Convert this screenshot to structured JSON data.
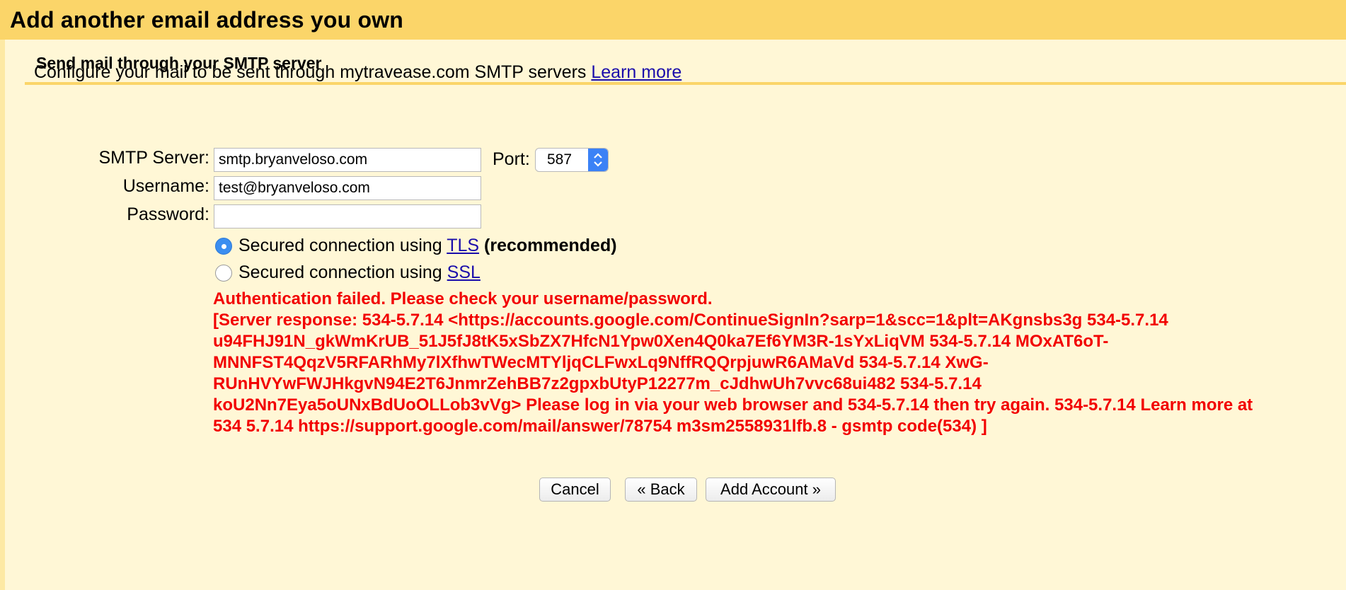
{
  "dialog": {
    "title": "Add another email address you own",
    "section_title": "Send mail through your SMTP server",
    "description": "Configure your mail to be sent through mytravease.com SMTP servers",
    "learn_more": "Learn more"
  },
  "form": {
    "smtp_label": "SMTP Server:",
    "smtp_value": "smtp.bryanveloso.com",
    "port_label": "Port:",
    "port_value": "587",
    "username_label": "Username:",
    "username_value": "test@bryanveloso.com",
    "password_label": "Password:",
    "password_value": "",
    "tls_prefix": "Secured connection using",
    "tls_link": "TLS",
    "tls_suffix": "(recommended)",
    "ssl_prefix": "Secured connection using",
    "ssl_link": "SSL",
    "selected_security": "TLS"
  },
  "error": {
    "title": "Authentication failed. Please check your username/password.",
    "lines": [
      "[Server response: 534-5.7.14 <https://accounts.google.com/ContinueSignIn?sarp=1&scc=1&plt=AKgnsbs3g 534-5.7.14",
      "u94FHJ91N_gkWmKrUB_51J5fJ8tK5xSbZX7HfcN1Ypw0Xen4Q0ka7Ef6YM3R-1sYxLiqVM 534-5.7.14 MOxAT6oT-",
      "MNNFST4QqzV5RFARhMy7lXfhwTWecMTYljqCLFwxLq9NffRQQrpjuwR6AMaVd 534-5.7.14 XwG-",
      "RUnHVYwFWJHkgvN94E2T6JnmrZehBB7z2gpxbUtyP12277m_cJdhwUh7vvc68ui482 534-5.7.14",
      "koU2Nn7Eya5oUNxBdUoOLLob3vVg> Please log in via your web browser and 534-5.7.14 then try again. 534-5.7.14 Learn more at",
      "534 5.7.14 https://support.google.com/mail/answer/78754 m3sm2558931lfb.8 - gsmtp code(534) ]"
    ]
  },
  "buttons": {
    "cancel": "Cancel",
    "back": "« Back",
    "add_account": "Add Account »"
  },
  "colors": {
    "title_bar": "#fbd569",
    "panel": "#fff7d6",
    "error": "#f20000",
    "link": "#1a0dab",
    "radio_selected": "#3b8ef0"
  }
}
